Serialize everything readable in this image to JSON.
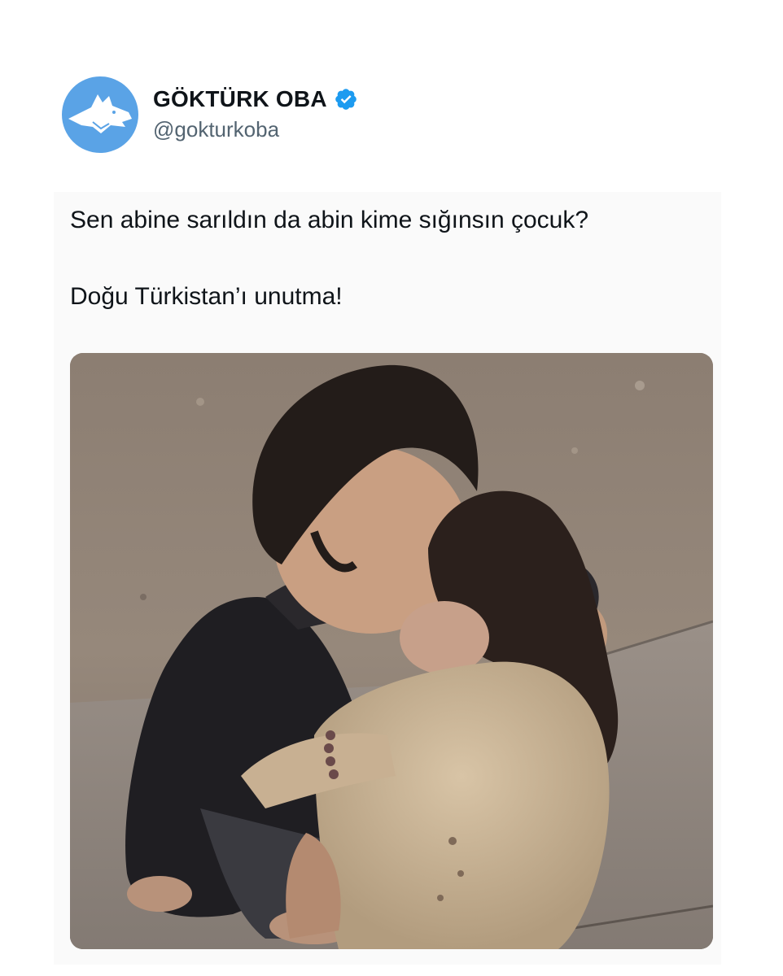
{
  "tweet": {
    "author": {
      "display_name": "GÖKTÜRK OBA",
      "handle": "@gokturkoba",
      "verified": true,
      "avatar_icon": "wolf-head-icon",
      "verified_icon": "verified-badge-icon"
    },
    "text_lines": [
      "Sen abine sarıldın da abin kime sığınsın çocuk?",
      "Doğu Türkistan’ı unutma!"
    ],
    "media": {
      "type": "photo"
    }
  },
  "colors": {
    "accent": "#1d9bf0",
    "avatar_bg": "#5aa3e6",
    "text_primary": "#0f1419",
    "text_secondary": "#536471"
  }
}
